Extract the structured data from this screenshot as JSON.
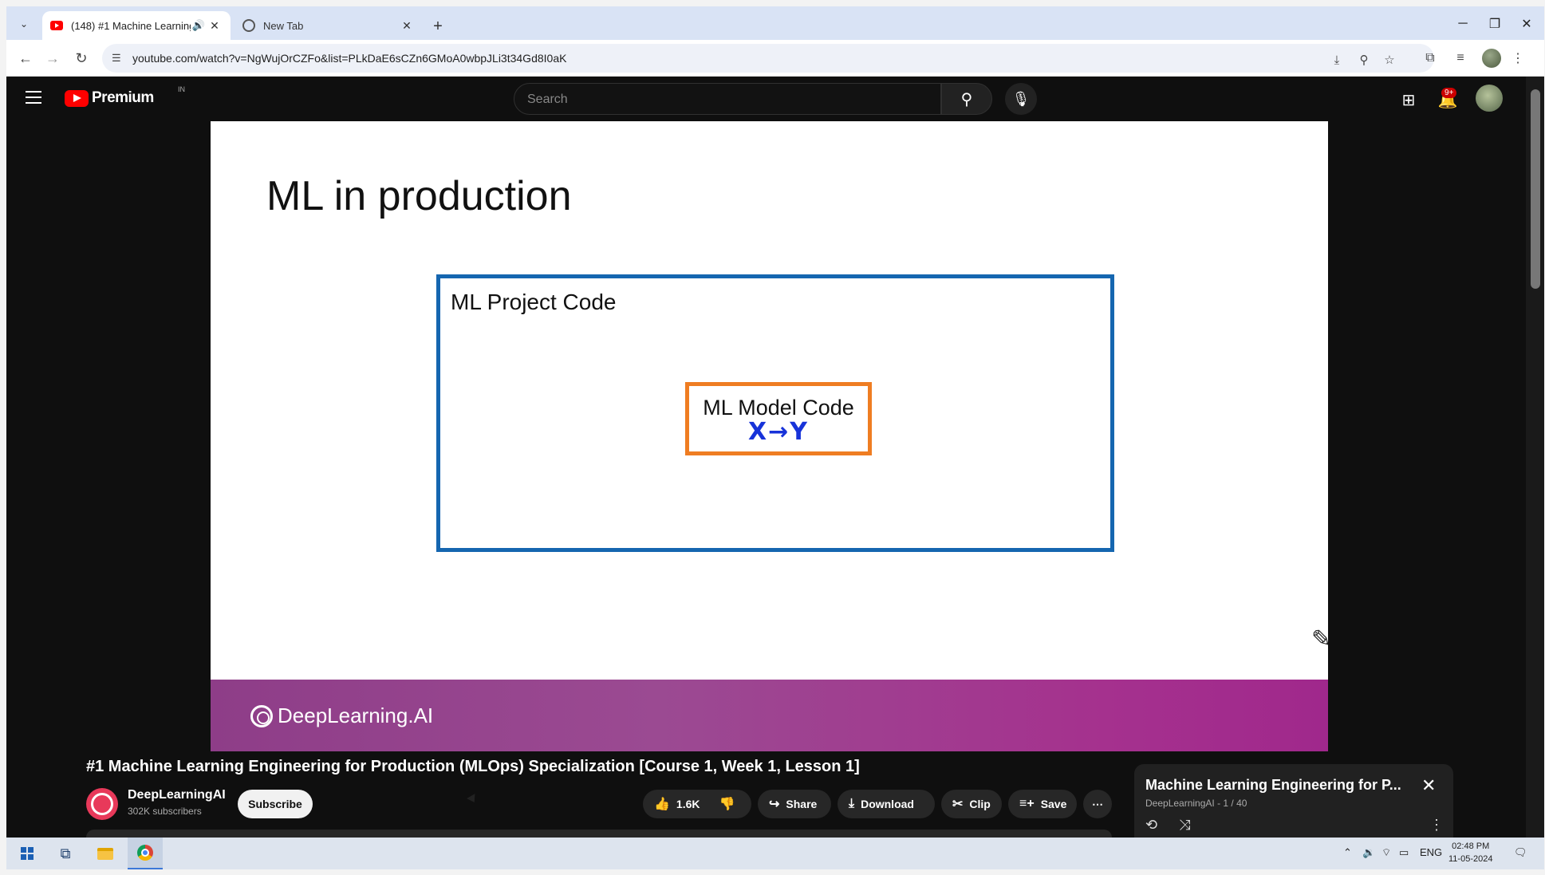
{
  "browser": {
    "tabs": [
      {
        "title": "(148) #1 Machine Learning",
        "active": true,
        "audio": true
      },
      {
        "title": "New Tab",
        "active": false
      }
    ],
    "url": "youtube.com/watch?v=NgWujOrCZFo&list=PLkDaE6sCZn6GMoA0wbpJLi3t34Gd8I0aK"
  },
  "youtube": {
    "logo_text": "Premium",
    "country_code": "IN",
    "search_placeholder": "Search",
    "notifications_badge": "9+"
  },
  "slide": {
    "title": "ML in production",
    "outer_box_label": "ML Project Code",
    "inner_box_label": "ML Model Code",
    "inner_annotation": "X→Y",
    "brand": "DeepLearning.AI",
    "colors": {
      "outer_box": "#1566b0",
      "inner_box": "#ef7d22",
      "annotation": "#1733d9",
      "band": "#9b4a92"
    }
  },
  "video": {
    "title": "#1 Machine Learning Engineering for Production (MLOps) Specialization [Course 1, Week 1, Lesson 1]",
    "channel": "DeepLearningAI",
    "subscribers": "302K subscribers",
    "subscribe_label": "Subscribe",
    "likes": "1.6K",
    "share_label": "Share",
    "download_label": "Download",
    "clip_label": "Clip",
    "save_label": "Save"
  },
  "playlist": {
    "title": "Machine Learning Engineering for P...",
    "subtitle": "DeepLearningAI - 1 / 40"
  },
  "taskbar": {
    "language": "ENG",
    "time": "02:48 PM",
    "date": "11-05-2024"
  }
}
